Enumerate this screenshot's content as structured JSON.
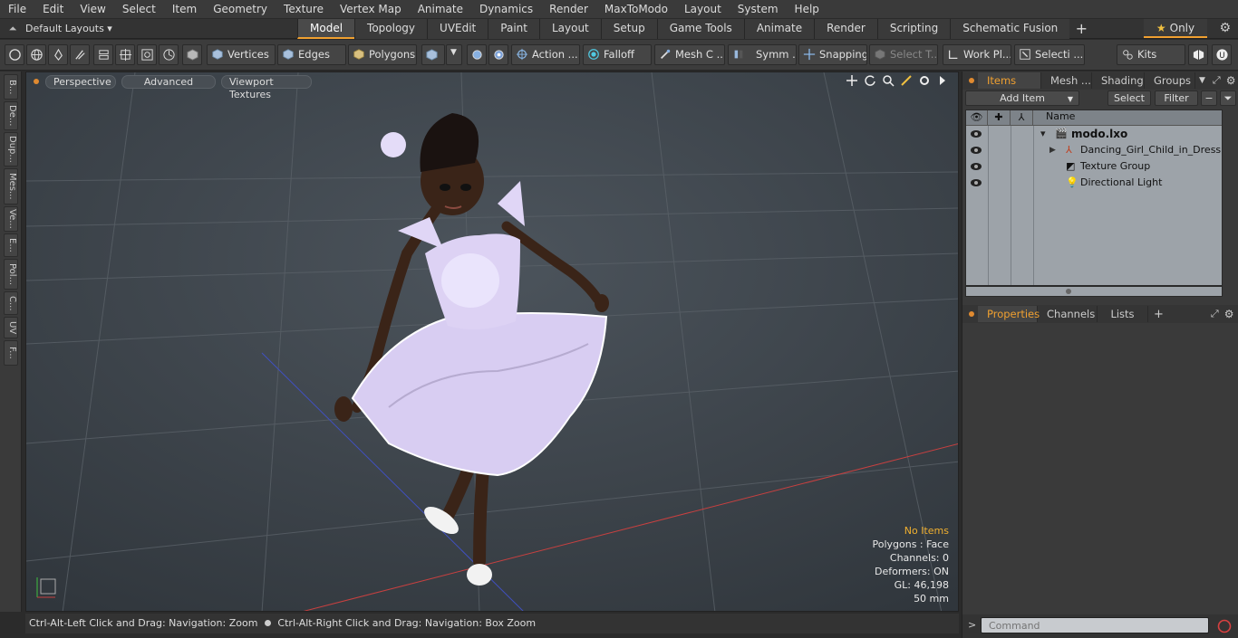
{
  "menu": [
    "File",
    "Edit",
    "View",
    "Select",
    "Item",
    "Geometry",
    "Texture",
    "Vertex Map",
    "Animate",
    "Dynamics",
    "Render",
    "MaxToModo",
    "Layout",
    "System",
    "Help"
  ],
  "layouts": {
    "selector": "Default Layouts ▾",
    "tabs": [
      "Model",
      "Topology",
      "UVEdit",
      "Paint",
      "Layout",
      "Setup",
      "Game Tools",
      "Animate",
      "Render",
      "Scripting",
      "Schematic Fusion"
    ],
    "active_tab": "Model",
    "add_tab": "+",
    "only_label": "Only"
  },
  "toolbar": {
    "vertices": "Vertices",
    "edges": "Edges",
    "polygons": "Polygons",
    "action": "Action ...",
    "falloff": "Falloff",
    "mesh_c": "Mesh C ...",
    "symm": "Symm ...",
    "snapping": "Snapping",
    "select_t": "Select T...",
    "work_pl": "Work Pl...",
    "selecti": "Selecti ...",
    "kits": "Kits"
  },
  "left_strip": [
    "B...",
    "De...",
    "Dup...",
    "Mes...",
    "Ve...",
    "E...",
    "Pol...",
    "C...",
    "UV",
    "F..."
  ],
  "viewport": {
    "perspective": "Perspective",
    "advanced": "Advanced",
    "viewport_textures": "Viewport Textures",
    "info": {
      "no_items": "No Items",
      "polygons": "Polygons : Face",
      "channels": "Channels: 0",
      "deformers": "Deformers: ON",
      "gl": "GL: 46,198",
      "focal": "50 mm"
    }
  },
  "status": {
    "left": "Ctrl-Alt-Left Click and Drag: Navigation: Zoom",
    "right": "Ctrl-Alt-Right Click and Drag: Navigation: Box Zoom"
  },
  "items_panel": {
    "tabs": [
      "Items",
      "Mesh ...",
      "Shading",
      "Groups"
    ],
    "active_tab": "Items",
    "add_item": "Add Item",
    "select": "Select",
    "filter": "Filter",
    "name_header": "Name",
    "rows": [
      {
        "label": "modo.lxo",
        "indent": 0
      },
      {
        "label": "Dancing_Girl_Child_in_Dress",
        "indent": 1
      },
      {
        "label": "Texture Group",
        "indent": 1
      },
      {
        "label": "Directional Light",
        "indent": 1
      }
    ]
  },
  "properties_panel": {
    "tabs": [
      "Properties",
      "Channels",
      "Lists"
    ],
    "active_tab": "Properties",
    "add": "+"
  },
  "command": {
    "placeholder": "Command",
    "prompt": ">"
  },
  "colors": {
    "accent": "#f0a030",
    "viewport_bg": "#3e464e",
    "dress": "#d8cdf2"
  }
}
